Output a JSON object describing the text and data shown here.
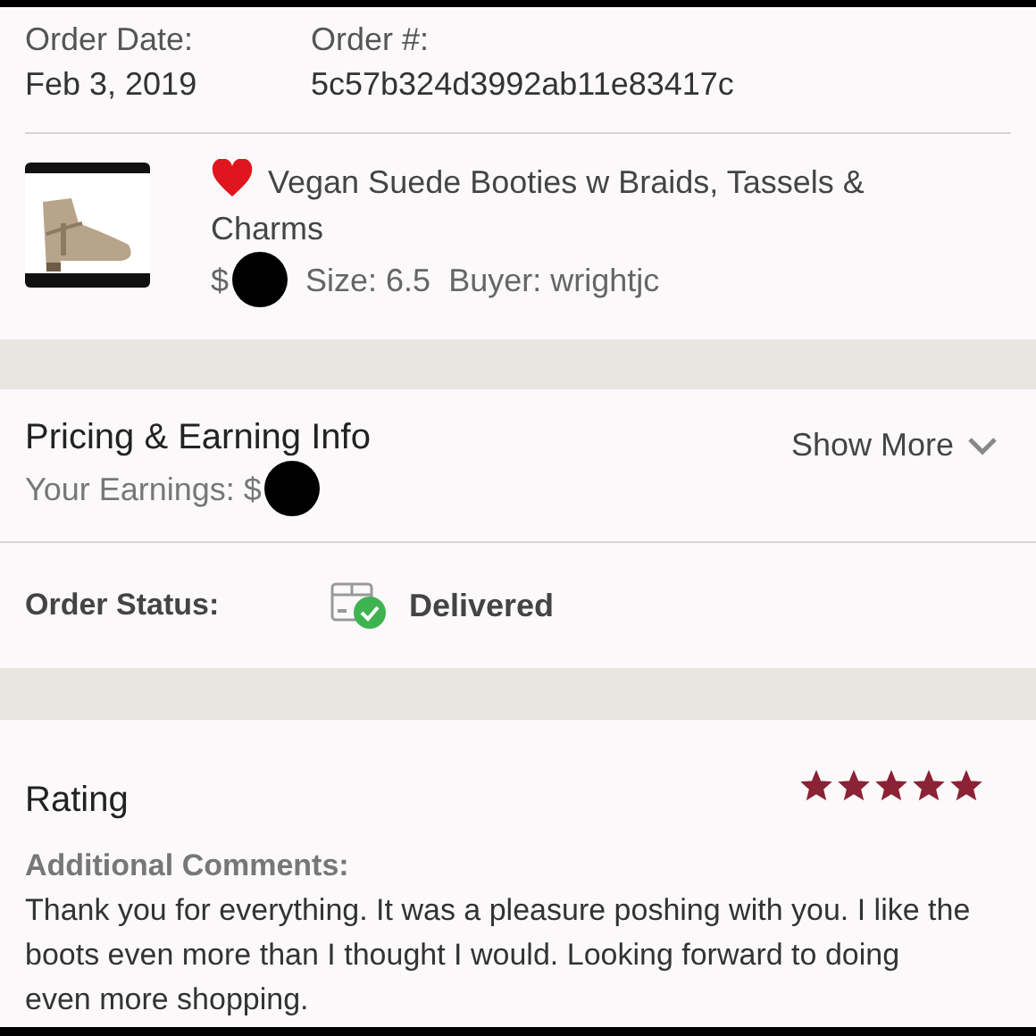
{
  "order": {
    "date_label": "Order Date:",
    "date": "Feb 3, 2019",
    "number_label": "Order #:",
    "number": "5c57b324d3992ab11e83417c"
  },
  "item": {
    "title": "Vegan Suede Booties w Braids, Tassels & Charms",
    "price": "$",
    "size": "Size: 6.5",
    "buyer": "Buyer: wrightjc"
  },
  "pricing": {
    "title": "Pricing & Earning Info",
    "earnings": "Your Earnings: $",
    "show_more": "Show More",
    "expanded": false
  },
  "status": {
    "label": "Order Status:",
    "value": "Delivered"
  },
  "rating": {
    "title": "Rating",
    "stars": 5,
    "comments_label": "Additional Comments:",
    "comments": "Thank you for everything. It was a pleasure poshing with you. I like the boots even more than I thought I would. Looking forward to doing even more shopping."
  }
}
